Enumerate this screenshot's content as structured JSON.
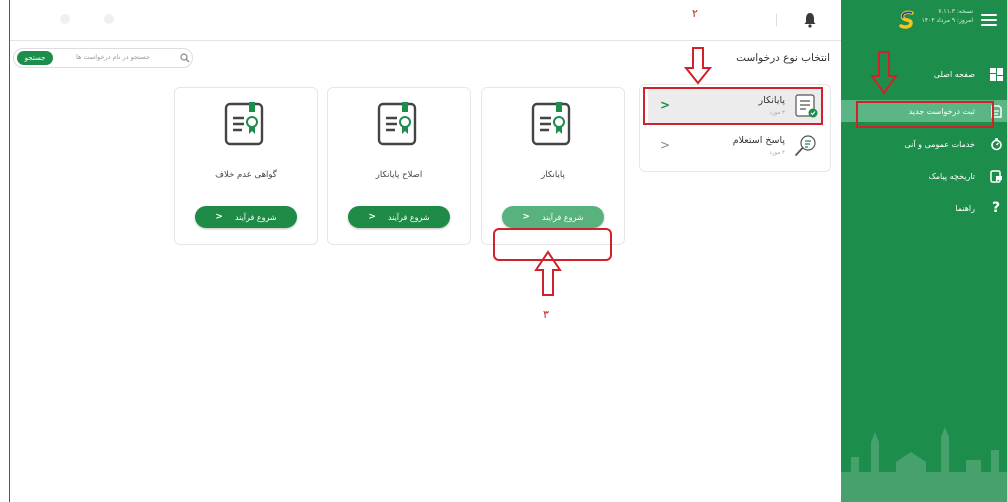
{
  "sidebar": {
    "version_label": "نسخه: ۷.۱۱.۳",
    "date_label": "امروز: ۹ مرداد ۱۴۰۳",
    "items": [
      {
        "label": "صفحه اصلی",
        "icon": "dashboard-icon"
      },
      {
        "label": "ثبت درخواست جدید",
        "icon": "new-request-icon"
      },
      {
        "label": "خدمات عمومی و آنی",
        "icon": "services-icon"
      },
      {
        "label": "تاریخچه پیامک",
        "icon": "sms-history-icon"
      },
      {
        "label": "راهنما",
        "icon": "help-icon"
      }
    ]
  },
  "page": {
    "title": "انتخاب نوع درخواست"
  },
  "search": {
    "placeholder": "جستجو در نام درخواست ها",
    "button": "جستجو"
  },
  "request_types": [
    {
      "title": "پایانکار",
      "count": "۳ مورد",
      "icon": "certificate-icon"
    },
    {
      "title": "پاسخ استعلام",
      "count": "۴ مورد",
      "icon": "inquiry-icon"
    }
  ],
  "cards": [
    {
      "title": "پایانکار",
      "button": "شروع فرآیند"
    },
    {
      "title": "اصلاح پایانکار",
      "button": "شروع فرآیند"
    },
    {
      "title": "گواهی عدم خلاف",
      "button": "شروع فرآیند"
    }
  ],
  "annotations": {
    "label_2": "۲",
    "label_3": "۳"
  },
  "colors": {
    "brand": "#1d8d4b",
    "active_button": "#58b27e",
    "annotation": "#d0222a"
  }
}
